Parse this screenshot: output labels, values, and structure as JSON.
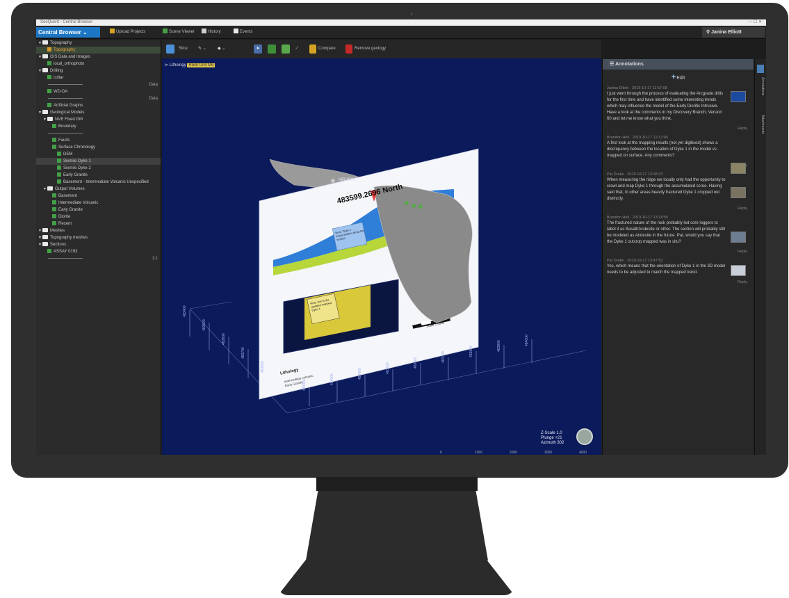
{
  "app": {
    "window_title": "SeeQuent - Central Browser",
    "window_controls": "—  ☐  ✕"
  },
  "menubar": {
    "branch_button": "Central Browser",
    "items": [
      "Upload Projects",
      "Scene Viewer",
      "History",
      "Events"
    ],
    "user": "Janina Elliott"
  },
  "tree": [
    {
      "label": "Topography",
      "type": "folder",
      "indent": 0
    },
    {
      "label": "Topography",
      "type": "orange",
      "indent": 1,
      "selected": true
    },
    {
      "label": "GIS Data and Images",
      "type": "folder",
      "indent": 0
    },
    {
      "label": "local_orthophoto",
      "type": "item",
      "indent": 1
    },
    {
      "label": "Drilling",
      "type": "folder",
      "indent": 0
    },
    {
      "label": "collar",
      "type": "item",
      "indent": 1
    },
    {
      "label": "",
      "type": "blank",
      "indent": 2,
      "side": "Data"
    },
    {
      "label": "WD-DA",
      "type": "item",
      "indent": 1
    },
    {
      "label": "",
      "type": "blank",
      "indent": 2,
      "side": "Data"
    },
    {
      "label": "Artificial Graphs",
      "type": "item",
      "indent": 1
    },
    {
      "label": "Geological Models",
      "type": "folder",
      "indent": 0
    },
    {
      "label": "NVE Fixed GM",
      "type": "folder",
      "indent": 1
    },
    {
      "label": "Boundary",
      "type": "item",
      "indent": 2
    },
    {
      "label": "",
      "type": "blank",
      "indent": 2
    },
    {
      "label": "Faults",
      "type": "item",
      "indent": 2
    },
    {
      "label": "Surface Chronology",
      "type": "green",
      "indent": 2
    },
    {
      "label": "DEM",
      "type": "item",
      "indent": 3
    },
    {
      "label": "Sixmile Dyke 1",
      "type": "item",
      "indent": 3,
      "highlight": true
    },
    {
      "label": "Sixmile Dyke 2",
      "type": "item",
      "indent": 3
    },
    {
      "label": "Early Granite",
      "type": "item",
      "indent": 3
    },
    {
      "label": "Basement - Intermediate Volcanic Unspecified",
      "type": "item",
      "indent": 3
    },
    {
      "label": "Output Volumes",
      "type": "folder",
      "indent": 1
    },
    {
      "label": "Basement",
      "type": "green",
      "indent": 2
    },
    {
      "label": "Intermediate Volcanic",
      "type": "green",
      "indent": 2
    },
    {
      "label": "Early Granite",
      "type": "green",
      "indent": 2
    },
    {
      "label": "Diorite",
      "type": "green",
      "indent": 2
    },
    {
      "label": "Recent",
      "type": "green",
      "indent": 2
    },
    {
      "label": "Meshes",
      "type": "folder",
      "indent": 0
    },
    {
      "label": "Topography meshes",
      "type": "folder",
      "indent": 0
    },
    {
      "label": "Sections",
      "type": "folder",
      "indent": 0
    },
    {
      "label": "ASSAY 0193",
      "type": "item",
      "indent": 1
    },
    {
      "label": "",
      "type": "blank",
      "indent": 2,
      "side": "1:1"
    }
  ],
  "toolbar": {
    "items": [
      "Slice",
      "Compare",
      "Remove geology"
    ]
  },
  "viewport": {
    "layer_label": "Lithology",
    "layer_tag": "Rock Unit Me",
    "section_title": "483599.2696 North",
    "callout_top": "Note: Dyke 1 interpretation along the section",
    "callout_bottom": "Note: this is the updated mapped Dyke 1",
    "legend_title": "Lithology",
    "legend_items": [
      "Intermediate volcanic",
      "Early Granite"
    ],
    "scale_label": "Scale 1:5000",
    "collar_label": "MRHD01",
    "hud_lines": [
      "Z-Scale 1.0",
      "Plunge +21",
      "Azimuth 302"
    ],
    "ruler_values": [
      "0",
      "1000",
      "2000",
      "3000",
      "4000"
    ],
    "axis_labels": [
      "483400",
      "483500",
      "483600",
      "483700",
      "483800",
      "483900",
      "484000"
    ]
  },
  "annotations": {
    "title": "Annotations",
    "edit_label": "Edit",
    "items": [
      {
        "author": "Janina Elliott",
        "date": "2019-10-17 11:57:08",
        "body": "I just went through the process of evaluating the Arcgrade drills for the first time and have identified some interesting trends which may influence the model of the Early Dioritic Intrusive. Have a look at the comments in my Discovery Branch, Version 60 and let me know what you think.",
        "reply": "Reply",
        "thumb_color": "#1b4a9e"
      },
      {
        "author": "Brandon Holt",
        "date": "2019-10-17 12:13:45",
        "body": "A first look at the mapping results (not yet digitised) shows a discrepancy between the location of Dyke 1 in the model vs. mapped on surface. Any comments?",
        "reply": "Reply",
        "thumb_color": "#8a8464"
      },
      {
        "author": "Pat Drake",
        "date": "2019-10-17 12:08:23",
        "body": "When measuring the ridge we locally only had the opportunity to crawl and map Dyke 1 through the accumulated scree. Having said that, in other areas heavily fractured Dyke 1 cropped out distinctly.",
        "reply": "Reply",
        "thumb_color": "#7a7260"
      },
      {
        "author": "Brandon Holt",
        "date": "2019-10-17 13:18:55",
        "body": "The fractured nature of the rock probably led core loggers to label it as Basalt/Andesite or other. The section will probably still be modeled as Andesite in the future. Pat, would you say that the Dyke 1 outcrop mapped was in situ?",
        "reply": "Reply",
        "thumb_color": "#6d7e92"
      },
      {
        "author": "Pat Drake",
        "date": "2019-10-17 13:47:52",
        "body": "Yes, which means that the orientation of Dyke 1 in the 3D model needs to be adjusted to match the mapped trend.",
        "reply": "Reply",
        "thumb_color": "#c8ced8"
      }
    ]
  },
  "sidetabs": [
    "Annotations",
    "Attachments"
  ],
  "colors": {
    "accent": "#1d76c4",
    "viewport_bg": "#0b1a5a",
    "panel_bg": "#2b2b2b",
    "bezel": "#2f2f2f"
  }
}
